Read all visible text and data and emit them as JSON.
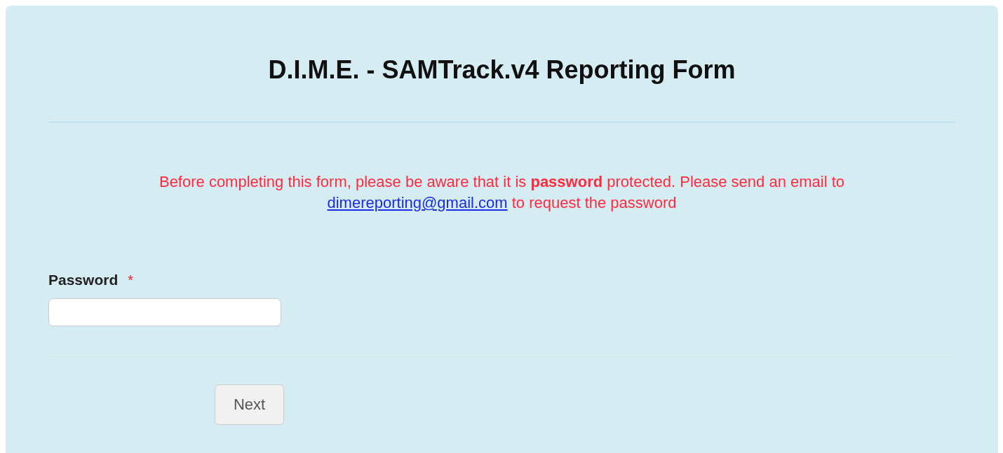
{
  "form": {
    "title": "D.I.M.E. - SAMTrack.v4 Reporting Form",
    "notice": {
      "text": "Before completing this form, please be aware that it is **password** protected. Please send an email to",
      "link": "dimereporting@gmail.com",
      "after": "to request the password"
    },
    "fields": [
      {
        "label": "Password",
        "required": true,
        "required_mark": "*"
      }
    ],
    "buttons": [
      {
        "label": "Next",
        "disabled": false
      }
    ]
  }
}
